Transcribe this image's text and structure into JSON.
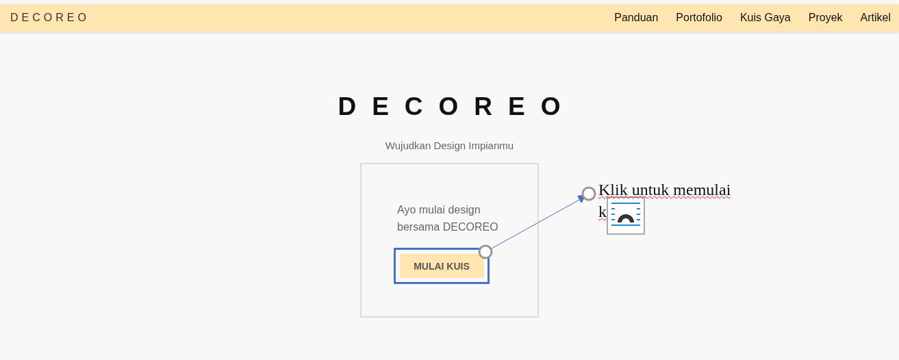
{
  "navbar": {
    "logo": "DECOREO",
    "links": [
      {
        "label": "Panduan"
      },
      {
        "label": "Portofolio"
      },
      {
        "label": "Kuis Gaya"
      },
      {
        "label": "Proyek"
      },
      {
        "label": "Artikel"
      }
    ]
  },
  "hero": {
    "title": "DECOREO",
    "subtitle": "Wujudkan Design Impianmu"
  },
  "card": {
    "text_lines": [
      "Ayo mulai design",
      "bersama DECOREO"
    ],
    "button": "MULAI KUIS",
    "selected": true
  },
  "annotation": {
    "lines": [
      "Klik untuk memulai",
      "k"
    ]
  }
}
